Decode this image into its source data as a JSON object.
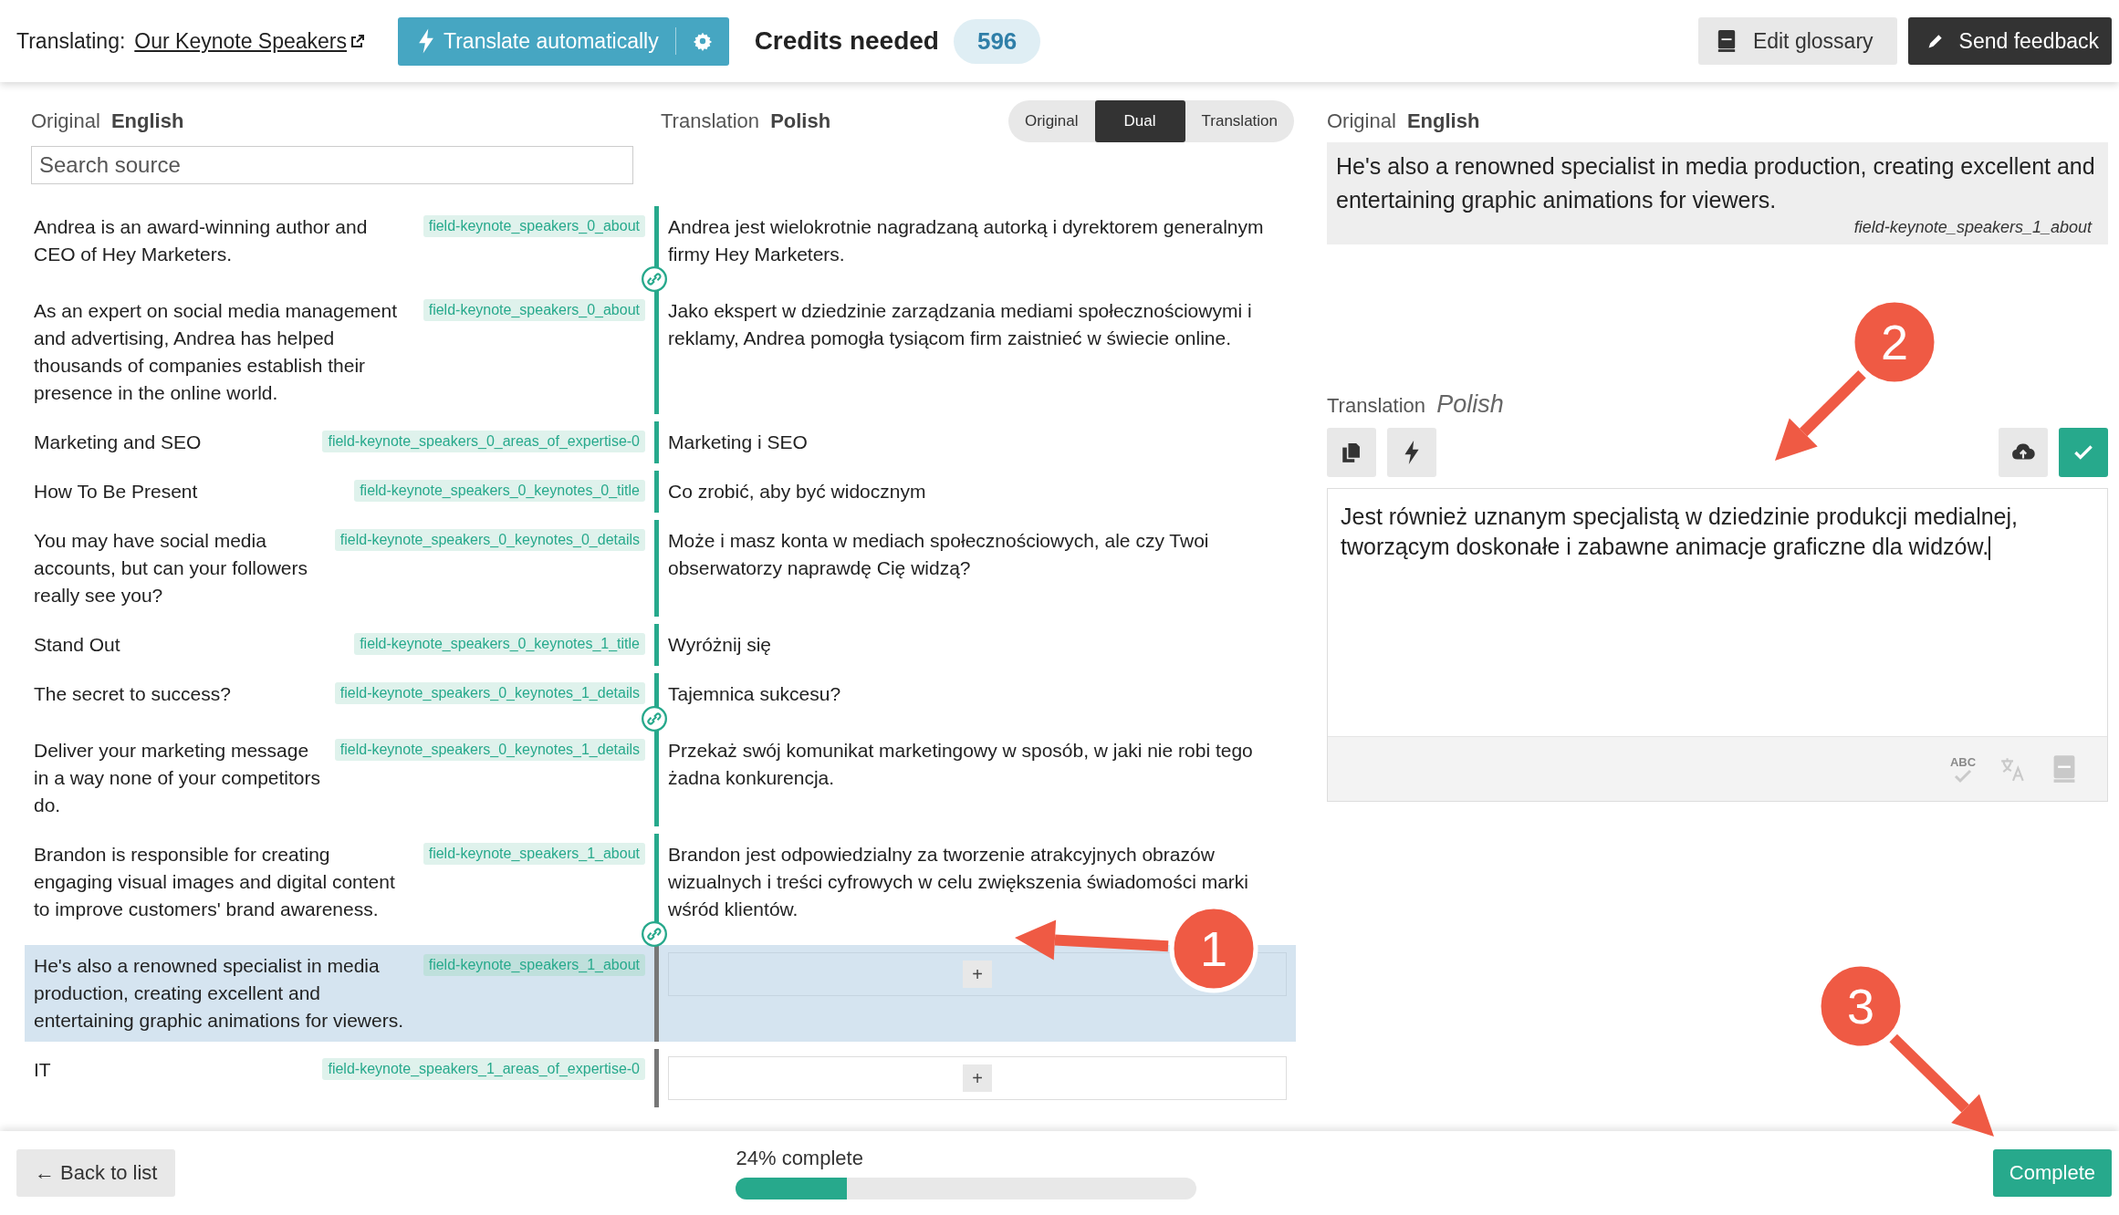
{
  "top_bar": {
    "translating_label": "Translating:",
    "page_link": "Our Keynote Speakers",
    "translate_button": "Translate automatically",
    "credits_label": "Credits needed",
    "credits": "596",
    "glossary_button": "Edit glossary",
    "feedback_button": "Send feedback"
  },
  "source_header": {
    "label": "Original",
    "language": "English"
  },
  "search": {
    "placeholder": "Search source"
  },
  "target_header": {
    "label": "Translation",
    "language": "Polish"
  },
  "view_modes": [
    {
      "label": "Original",
      "selected": false
    },
    {
      "label": "Dual",
      "selected": true
    },
    {
      "label": "Translation",
      "selected": false
    }
  ],
  "rows": [
    {
      "source": "Andrea is an award-winning author and CEO of Hey Marketers.",
      "tag": "field-keynote_speakers_0_about",
      "translation": "Andrea jest wielokrotnie nagradzaną autorką i dyrektorem generalnym firmy Hey Marketers.",
      "selected": false,
      "linked": true
    },
    {
      "source": "As an expert on social media management and advertising, Andrea has helped thousands of companies establish their presence in the online world.",
      "tag": "field-keynote_speakers_0_about",
      "translation": "Jako ekspert w dziedzinie zarządzania mediami społecznościowymi i reklamy, Andrea pomogła tysiącom firm zaistnieć w świecie online.",
      "selected": false,
      "linked": false
    },
    {
      "source": "Marketing and SEO",
      "tag": "field-keynote_speakers_0_areas_of_expertise-0",
      "translation": "Marketing i SEO",
      "selected": false,
      "linked": false
    },
    {
      "source": "How To Be Present",
      "tag": "field-keynote_speakers_0_keynotes_0_title",
      "translation": "Co zrobić, aby być widocznym",
      "selected": false,
      "linked": false
    },
    {
      "source": "You may have social media accounts, but can your followers really see you?",
      "tag": "field-keynote_speakers_0_keynotes_0_details",
      "translation": "Może i masz konta w mediach społecznościowych, ale czy Twoi obserwatorzy naprawdę Cię widzą?",
      "selected": false,
      "linked": false
    },
    {
      "source": "Stand Out",
      "tag": "field-keynote_speakers_0_keynotes_1_title",
      "translation": "Wyróżnij się",
      "selected": false,
      "linked": false
    },
    {
      "source": "The secret to success?",
      "tag": "field-keynote_speakers_0_keynotes_1_details",
      "translation": "Tajemnica sukcesu?",
      "selected": false,
      "linked": true
    },
    {
      "source": "Deliver your marketing message in a way none of your competitors do.",
      "tag": "field-keynote_speakers_0_keynotes_1_details",
      "translation": "Przekaż swój komunikat marketingowy w sposób, w jaki nie robi tego żadna konkurencja.",
      "selected": false,
      "linked": false
    },
    {
      "source": "Brandon is responsible for creating engaging visual images and digital content to improve customers' brand awareness.",
      "tag": "field-keynote_speakers_1_about",
      "translation": "Brandon jest odpowiedzialny za tworzenie atrakcyjnych obrazów wizualnych i treści cyfrowych w celu zwiększenia świadomości marki wśród klientów.",
      "selected": false,
      "linked": true
    },
    {
      "source": "He's also a renowned specialist in media production, creating excellent and entertaining graphic animations for viewers.",
      "tag": "field-keynote_speakers_1_about",
      "add_label": "+",
      "selected": true,
      "linked": false
    },
    {
      "source": "IT",
      "tag": "field-keynote_speakers_1_areas_of_expertise-0",
      "add_label": "+",
      "selected": false,
      "linked": false
    }
  ],
  "editor": {
    "source_label": "Original",
    "source_language": "English",
    "source_text": "He's also a renowned specialist in media production, creating excellent and entertaining graphic animations for viewers.",
    "source_tag": "field-keynote_speakers_1_about",
    "target_label": "Translation",
    "target_language": "Polish",
    "value": "Jest również uznanym specjalistą w dziedzinie produkcji medialnej, tworzącym doskonałe i zabawne animacje graficzne dla widzów.",
    "spellcheck_label": "ABC"
  },
  "bottom_bar": {
    "back_button": "← Back to list",
    "progress_label": "24% complete",
    "level": 0.24,
    "complete_button": "Complete"
  },
  "callouts": [
    {
      "number": "1"
    },
    {
      "number": "2"
    },
    {
      "number": "3"
    }
  ]
}
